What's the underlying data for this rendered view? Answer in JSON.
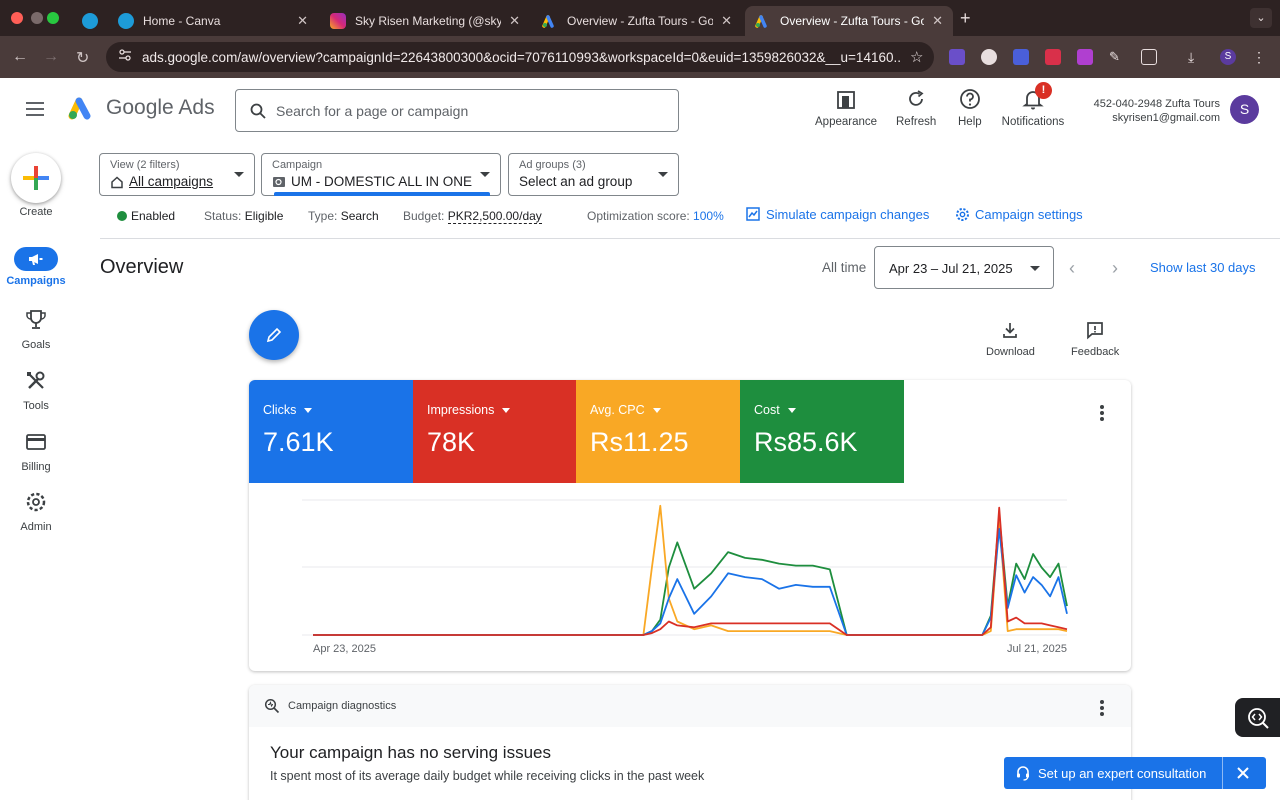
{
  "browser": {
    "tabs": [
      {
        "title": ""
      },
      {
        "title": "Home - Canva"
      },
      {
        "title": "Sky Risen Marketing (@sky_r"
      },
      {
        "title": "Overview - Zufta Tours - Goo"
      },
      {
        "title": "Overview - Zufta Tours - Goo"
      }
    ],
    "url": "ads.google.com/aw/overview?campaignId=22643800300&ocid=7076110993&workspaceId=0&euid=1359826032&__u=14160..."
  },
  "header": {
    "product_name": "Google Ads",
    "search_placeholder": "Search for a page or campaign",
    "buttons": {
      "appearance": "Appearance",
      "refresh": "Refresh",
      "help": "Help",
      "notifications": "Notifications"
    },
    "notification_badge": "!",
    "account_line1": "452-040-2948 Zufta Tours",
    "account_line2": "skyrisen1@gmail.com",
    "avatar_letter": "S"
  },
  "leftnav": {
    "create": "Create",
    "items": [
      {
        "label": "Campaigns",
        "icon": "megaphone-icon",
        "active": true
      },
      {
        "label": "Goals",
        "icon": "trophy-icon"
      },
      {
        "label": "Tools",
        "icon": "tools-icon"
      },
      {
        "label": "Billing",
        "icon": "credit-card-icon"
      },
      {
        "label": "Admin",
        "icon": "gear-icon"
      }
    ]
  },
  "filters": {
    "view": {
      "label": "View (2 filters)",
      "value": "All campaigns"
    },
    "campaign": {
      "label": "Campaign",
      "value": "UM - DOMESTIC ALL IN ONE"
    },
    "adgroups": {
      "label": "Ad groups (3)",
      "value": "Select an ad group"
    }
  },
  "status": {
    "enabled": "Enabled",
    "status_label": "Status:",
    "status_value": "Eligible",
    "type_label": "Type:",
    "type_value": "Search",
    "budget_label": "Budget:",
    "budget_value": "PKR2,500.00/day",
    "opt_label": "Optimization score:",
    "opt_value": "100%",
    "simulate": "Simulate campaign changes",
    "settings": "Campaign settings"
  },
  "overview": {
    "title": "Overview",
    "all_time": "All time",
    "date_range": "Apr 23 – Jul 21, 2025",
    "show_last": "Show last 30 days",
    "download": "Download",
    "feedback": "Feedback"
  },
  "metrics": [
    {
      "name": "Clicks",
      "value": "7.61K",
      "color": "#1a73e8"
    },
    {
      "name": "Impressions",
      "value": "78K",
      "color": "#d93025"
    },
    {
      "name": "Avg. CPC",
      "value": "Rs11.25",
      "color": "#f9a825"
    },
    {
      "name": "Cost",
      "value": "Rs85.6K",
      "color": "#1e8e3e"
    }
  ],
  "chart_data": {
    "type": "line",
    "x_start_label": "Apr 23, 2025",
    "x_end_label": "Jul 21, 2025",
    "x": [
      "Apr 23, 2025",
      "Apr 26, 2025",
      "Apr 29, 2025",
      "May 2, 2025",
      "May 5, 2025",
      "May 8, 2025",
      "May 11, 2025",
      "May 14, 2025",
      "May 17, 2025",
      "May 20, 2025",
      "May 23, 2025",
      "May 26, 2025",
      "May 29, 2025",
      "Jun 1, 2025",
      "Jun 2, 2025",
      "Jun 3, 2025",
      "Jun 4, 2025",
      "Jun 5, 2025",
      "Jun 7, 2025",
      "Jun 9, 2025",
      "Jun 11, 2025",
      "Jun 13, 2025",
      "Jun 15, 2025",
      "Jun 17, 2025",
      "Jun 19, 2025",
      "Jun 21, 2025",
      "Jun 23, 2025",
      "Jun 25, 2025",
      "Jun 27, 2025",
      "Jun 29, 2025",
      "Jul 1, 2025",
      "Jul 3, 2025",
      "Jul 6, 2025",
      "Jul 9, 2025",
      "Jul 11, 2025",
      "Jul 12, 2025",
      "Jul 13, 2025",
      "Jul 14, 2025",
      "Jul 15, 2025",
      "Jul 16, 2025",
      "Jul 17, 2025",
      "Jul 18, 2025",
      "Jul 19, 2025",
      "Jul 20, 2025",
      "Jul 21, 2025"
    ],
    "series": [
      {
        "name": "Clicks",
        "color": "#1a73e8",
        "values": [
          0,
          0,
          0,
          0,
          0,
          0,
          0,
          0,
          0,
          0,
          0,
          0,
          0,
          0,
          4,
          12,
          38,
          58,
          22,
          40,
          64,
          60,
          58,
          48,
          52,
          50,
          50,
          0,
          0,
          0,
          0,
          0,
          0,
          0,
          0,
          18,
          110,
          28,
          62,
          44,
          60,
          52,
          40,
          60,
          22
        ]
      },
      {
        "name": "Impressions",
        "color": "#d93025",
        "values": [
          0,
          0,
          0,
          0,
          0,
          0,
          0,
          0,
          0,
          0,
          0,
          0,
          0,
          0,
          2,
          6,
          14,
          10,
          8,
          12,
          12,
          12,
          12,
          12,
          12,
          12,
          12,
          0,
          0,
          0,
          0,
          0,
          0,
          0,
          0,
          8,
          132,
          14,
          18,
          12,
          12,
          12,
          10,
          8,
          6
        ]
      },
      {
        "name": "Avg. CPC",
        "color": "#f9a825",
        "values": [
          0,
          0,
          0,
          0,
          0,
          0,
          0,
          0,
          0,
          0,
          0,
          0,
          0,
          0,
          70,
          134,
          38,
          14,
          6,
          10,
          4,
          4,
          4,
          4,
          4,
          4,
          4,
          0,
          0,
          0,
          0,
          0,
          0,
          0,
          0,
          4,
          120,
          4,
          6,
          6,
          6,
          6,
          6,
          6,
          4
        ]
      },
      {
        "name": "Cost",
        "color": "#1e8e3e",
        "values": [
          0,
          0,
          0,
          0,
          0,
          0,
          0,
          0,
          0,
          0,
          0,
          0,
          0,
          0,
          4,
          16,
          70,
          96,
          48,
          64,
          86,
          80,
          78,
          74,
          72,
          72,
          68,
          0,
          0,
          0,
          0,
          0,
          0,
          0,
          0,
          20,
          124,
          30,
          74,
          58,
          84,
          70,
          60,
          74,
          30
        ]
      }
    ],
    "ylim": [
      0,
      140
    ],
    "grid": true
  },
  "diagnostics": {
    "label": "Campaign diagnostics",
    "title": "Your campaign has no serving issues",
    "subtitle": "It spent most of its average daily budget while receiving clicks in the past week"
  },
  "consultation": {
    "label": "Set up an expert consultation"
  }
}
